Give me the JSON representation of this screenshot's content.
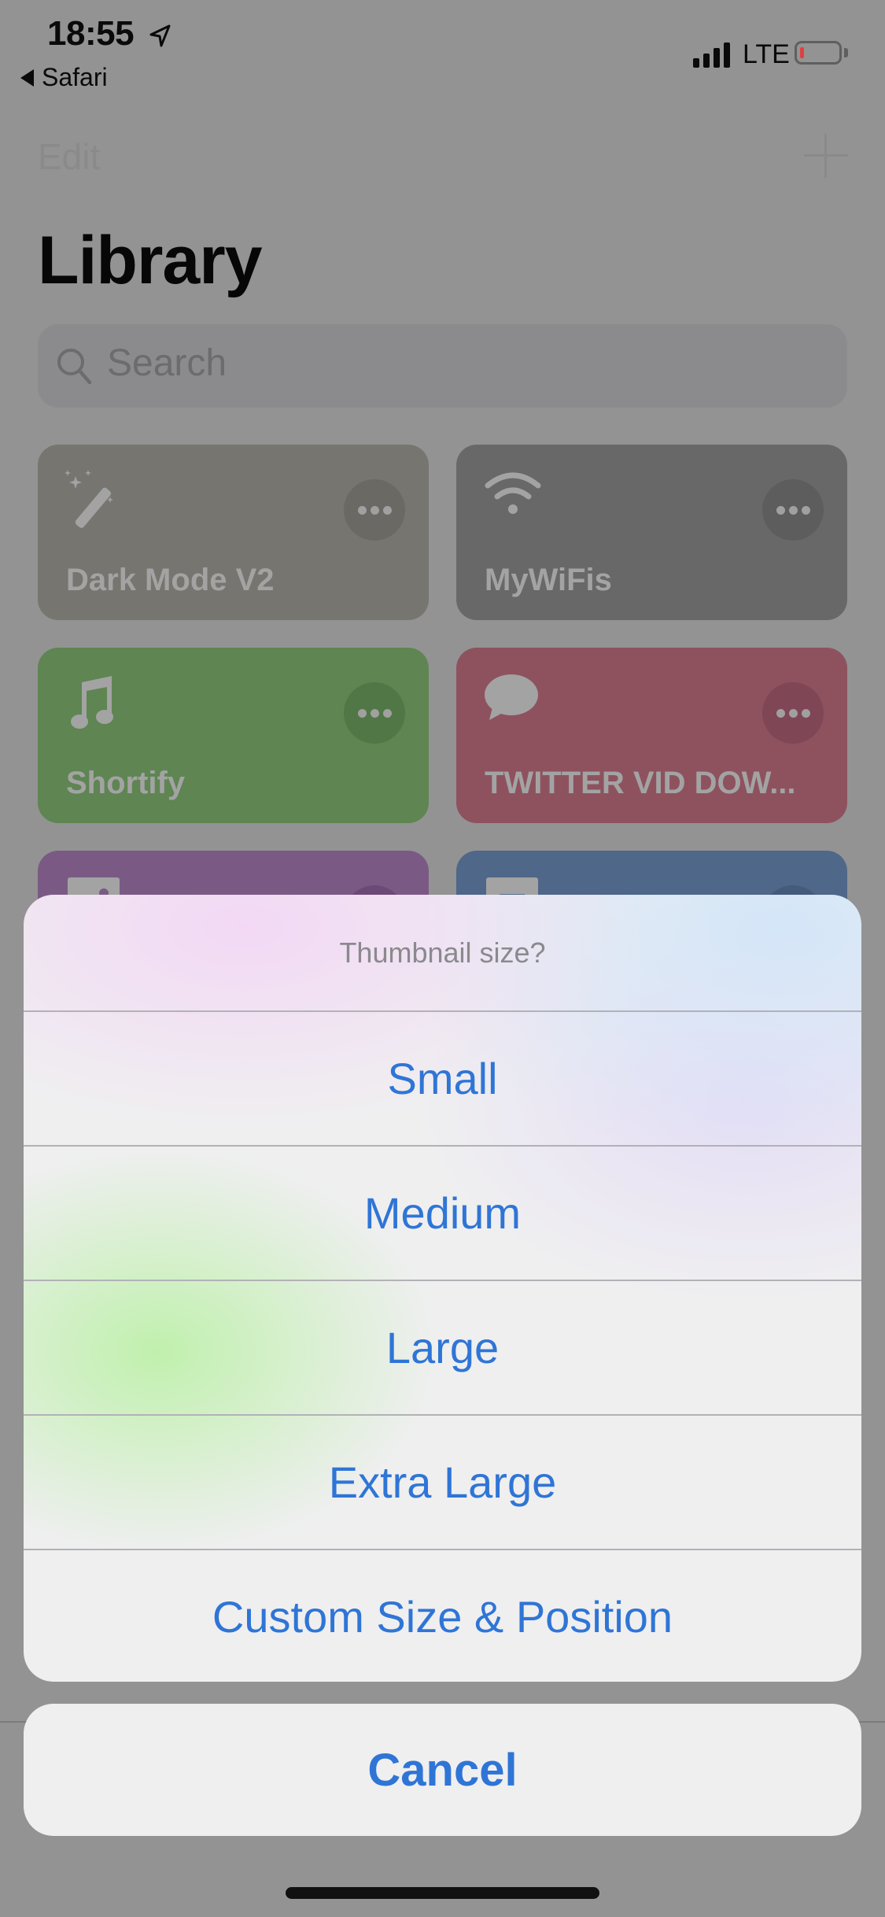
{
  "status_bar": {
    "time": "18:55",
    "location_icon": "location-arrow-icon",
    "back_app": "Safari",
    "network": "LTE",
    "signal_bars": 4,
    "battery_level_fraction": 0.08,
    "battery_color": "#e04040"
  },
  "nav": {
    "edit_label": "Edit",
    "add_icon": "plus-icon"
  },
  "page": {
    "title": "Library"
  },
  "search": {
    "placeholder": "Search",
    "icon": "search-icon"
  },
  "shortcuts": [
    {
      "name": "Dark Mode V2",
      "icon": "magic-wand-icon",
      "color": "#76756f",
      "more_color": "#6a6964"
    },
    {
      "name": "MyWiFis",
      "icon": "wifi-icon",
      "color": "#686868",
      "more_color": "#5d5d5d"
    },
    {
      "name": "Shortify",
      "icon": "music-note-icon",
      "color": "#5e8552",
      "more_color": "#517746"
    },
    {
      "name": "TWITTER VID DOW...",
      "icon": "speech-bubble-icon",
      "color": "#8e525f",
      "more_color": "#7f4655"
    },
    {
      "name": "",
      "icon": "image-icon",
      "color": "#7a5a85",
      "more_color": "#6b4a78"
    },
    {
      "name": "",
      "icon": "text-icon",
      "color": "#4f6788",
      "more_color": "#445b7c"
    }
  ],
  "action_sheet": {
    "title": "Thumbnail size?",
    "options": [
      "Small",
      "Medium",
      "Large",
      "Extra Large",
      "Custom Size & Position"
    ],
    "cancel_label": "Cancel",
    "accent_color": "#2f75d6"
  }
}
